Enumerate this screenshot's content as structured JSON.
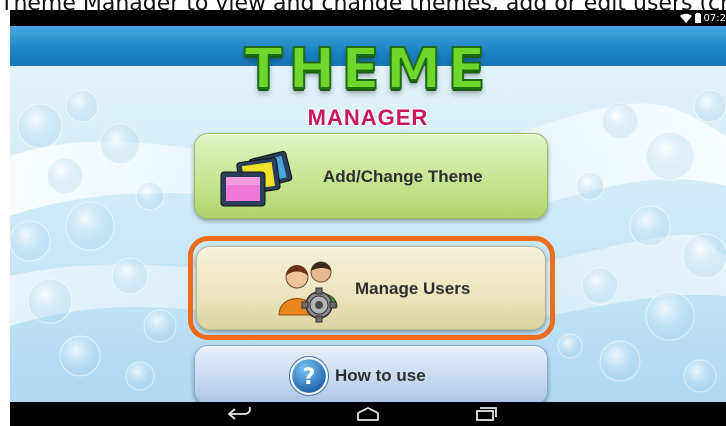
{
  "caption": {
    "text": "Theme Manager to view and change themes, add or edit users (choose an app user profile), or get help"
  },
  "status_bar": {
    "time": "07:2"
  },
  "logo": {
    "title": "THEME",
    "subtitle": "MANAGER"
  },
  "menu": {
    "add_change_theme": "Add/Change Theme",
    "manage_users": "Manage Users",
    "how_to_use": "How to use"
  },
  "colors": {
    "header_blue": "#1f86c9",
    "logo_green": "#6fd62c",
    "subtitle_magenta": "#c8185f",
    "focus_orange": "#ee6c1b"
  },
  "icons": {
    "theme_button": "picture-frames-icon",
    "users_button": "users-gear-icon",
    "howto_button": "question-mark-icon",
    "nav": [
      "back-icon",
      "home-icon",
      "recent-apps-icon"
    ],
    "status": [
      "wifi-icon",
      "battery-icon"
    ]
  }
}
